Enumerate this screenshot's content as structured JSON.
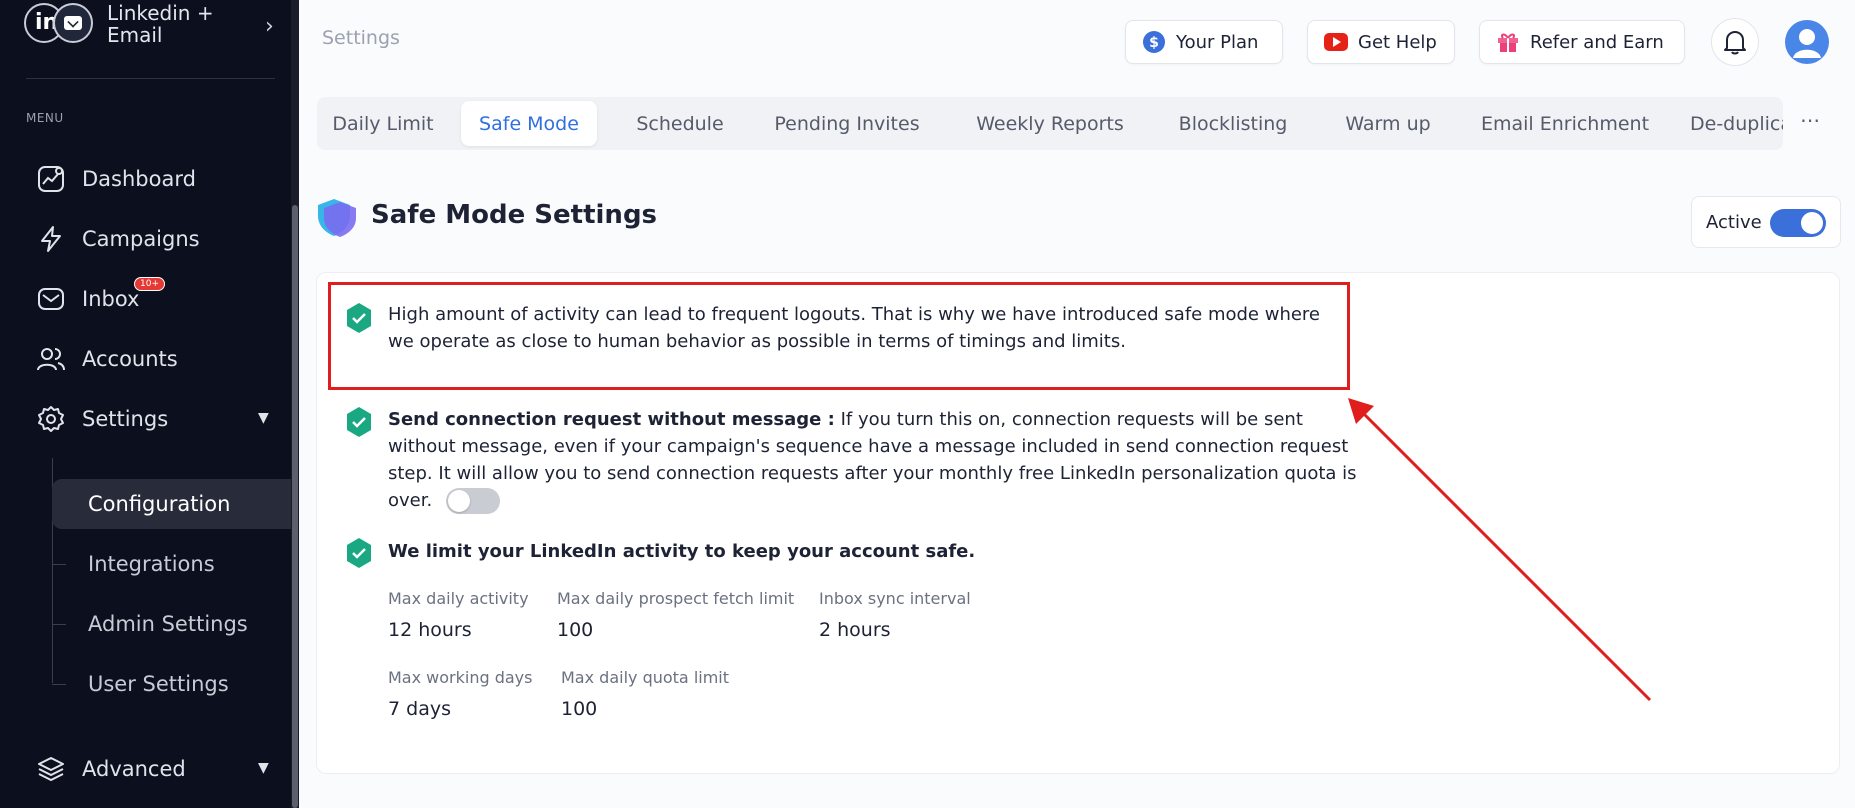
{
  "account": {
    "initial": "in",
    "name": "Linkedin + Email"
  },
  "sidebar": {
    "menu_label": "MENU",
    "items": [
      {
        "label": "Dashboard",
        "icon": "chart-icon"
      },
      {
        "label": "Campaigns",
        "icon": "bolt-icon"
      },
      {
        "label": "Inbox",
        "icon": "inbox-icon",
        "badge": "10+"
      },
      {
        "label": "Accounts",
        "icon": "users-icon"
      },
      {
        "label": "Settings",
        "icon": "gear-icon"
      }
    ],
    "settings_sub": [
      "Configuration",
      "Integrations",
      "Admin Settings",
      "User Settings"
    ],
    "advanced": "Advanced"
  },
  "header": {
    "breadcrumb": "Settings",
    "buttons": {
      "plan": "Your Plan",
      "help": "Get Help",
      "refer": "Refer and Earn"
    }
  },
  "tabs": [
    "Daily Limit",
    "Safe Mode",
    "Schedule",
    "Pending Invites",
    "Weekly Reports",
    "Blocklisting",
    "Warm up",
    "Email Enrichment",
    "De-duplication Settin"
  ],
  "tabs_more": "⋯",
  "page": {
    "title": "Safe Mode Settings",
    "active_label": "Active",
    "active_on": true
  },
  "notes": {
    "intro": "High amount of activity can lead to frequent logouts. That is why we have introduced safe mode where we operate as close to human behavior as possible in terms of timings and limits.",
    "conn_title": "Send connection request without message :",
    "conn_body": "If you turn this on, connection requests will be sent without message, even if your campaign's sequence have a message included in send connection request step. It will allow you to send connection requests after your monthly free LinkedIn personalization quota is over.",
    "conn_toggle_on": false,
    "limit_title": "We limit your LinkedIn activity to keep your account safe."
  },
  "stats": [
    {
      "label": "Max daily activity",
      "value": "12 hours"
    },
    {
      "label": "Max daily prospect fetch limit",
      "value": "100"
    },
    {
      "label": "Inbox sync interval",
      "value": "2 hours"
    },
    {
      "label": "Max working days",
      "value": "7 days"
    },
    {
      "label": "Max daily quota limit",
      "value": "100"
    }
  ],
  "colors": {
    "accent": "#2f6fe4",
    "check": "#1aa883",
    "annotation": "#e01e1e",
    "sidebar": "#0c0f1d"
  }
}
